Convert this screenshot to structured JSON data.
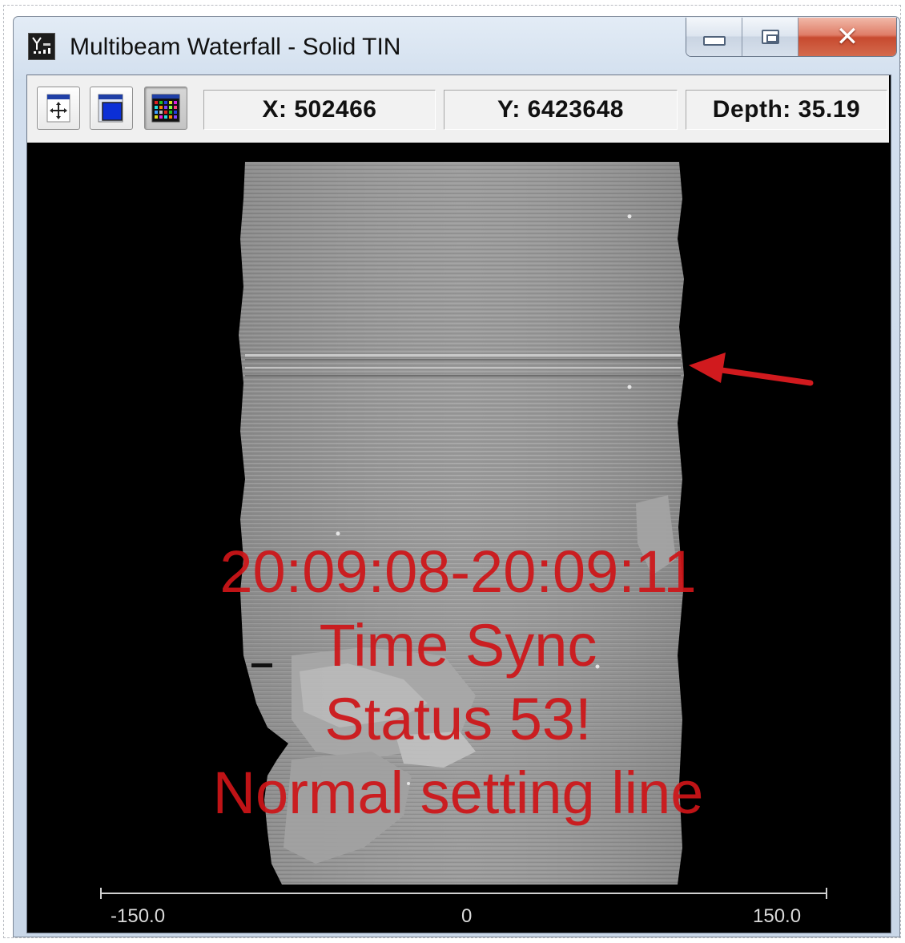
{
  "window": {
    "title": "Multibeam Waterfall - Solid TIN",
    "app_icon": "multibeam-app-icon",
    "caption_buttons": {
      "minimize": "minimize-icon",
      "maximize": "maximize-icon",
      "close": "✕"
    }
  },
  "toolbar": {
    "buttons": [
      {
        "name": "pan-view-button",
        "icon": "move-arrows-icon",
        "active": false
      },
      {
        "name": "window-view-button",
        "icon": "window-icon",
        "active": false
      },
      {
        "name": "color-palette-button",
        "icon": "color-grid-icon",
        "active": true
      }
    ],
    "x_readout": "X: 502466",
    "y_readout": "Y: 6423648",
    "depth_readout": "Depth: 35.19"
  },
  "viewport": {
    "background": "#000000",
    "swath_color": "#9a9a9a",
    "annotation_color": "#d11a1e",
    "overlay_lines": [
      "20:09:08-20:09:11",
      "Time Sync",
      "Status 53!",
      "Normal setting line"
    ],
    "arrow": "red-arrow-pointing-left",
    "axis": {
      "tick_labels": [
        "-150.0",
        "0",
        "150.0"
      ],
      "range": [
        -150,
        150
      ]
    }
  }
}
